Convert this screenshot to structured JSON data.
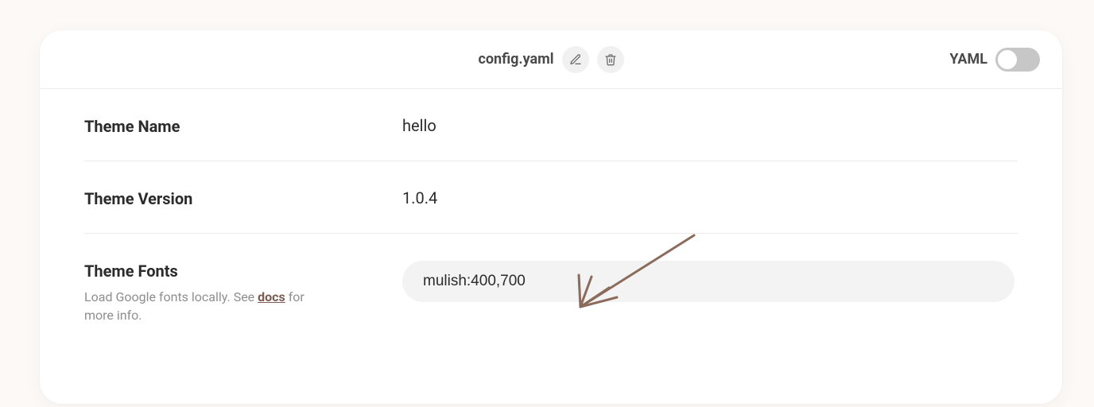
{
  "header": {
    "filename": "config.yaml",
    "yaml_toggle_label": "YAML",
    "yaml_toggle_on": false
  },
  "fields": {
    "theme_name": {
      "label": "Theme Name",
      "value": "hello"
    },
    "theme_version": {
      "label": "Theme Version",
      "value": "1.0.4"
    },
    "theme_fonts": {
      "label": "Theme Fonts",
      "description_pre": "Load Google fonts locally. See ",
      "description_link_text": "docs",
      "description_post": " for more info.",
      "value": "mulish:400,700"
    }
  }
}
